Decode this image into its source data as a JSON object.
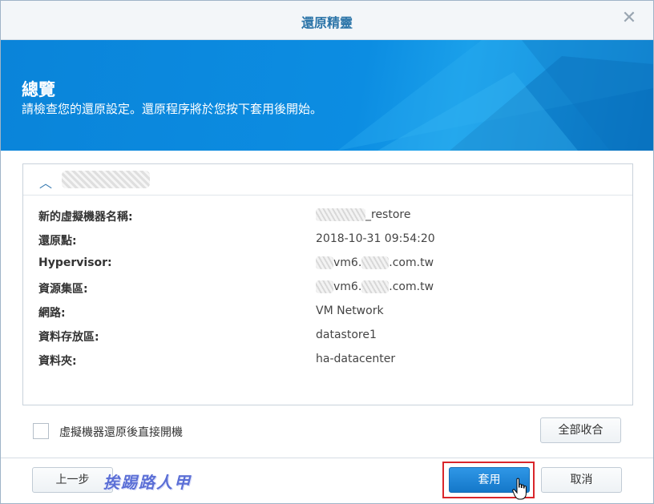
{
  "window": {
    "title": "還原精靈",
    "close_icon": "close-icon"
  },
  "banner": {
    "title": "總覽",
    "subtitle": "請檢查您的還原設定。還原程序將於您按下套用後開始。"
  },
  "summary": {
    "rows": [
      {
        "label": "新的虛擬機器名稱:",
        "value": "_restore"
      },
      {
        "label": "還原點:",
        "value": "2018-10-31 09:54:20"
      },
      {
        "label": "Hypervisor:",
        "value_prefix": "vm6.",
        "value_suffix": ".com.tw"
      },
      {
        "label": "資源集區:",
        "value_prefix": "vm6.",
        "value_suffix": ".com.tw"
      },
      {
        "label": "網路:",
        "value": "VM Network"
      },
      {
        "label": "資料存放區:",
        "value": "datastore1"
      },
      {
        "label": "資料夾:",
        "value": "ha-datacenter"
      }
    ]
  },
  "options": {
    "power_on_label": "虛擬機器還原後直接開機",
    "power_on_checked": false
  },
  "buttons": {
    "collapse_all": "全部收合",
    "back": "上一步",
    "apply": "套用",
    "cancel": "取消"
  },
  "watermark": "挨踢路人甲",
  "colors": {
    "accent": "#0a84d9",
    "primary_button": "#1f86d6",
    "highlight": "#d9262b"
  }
}
